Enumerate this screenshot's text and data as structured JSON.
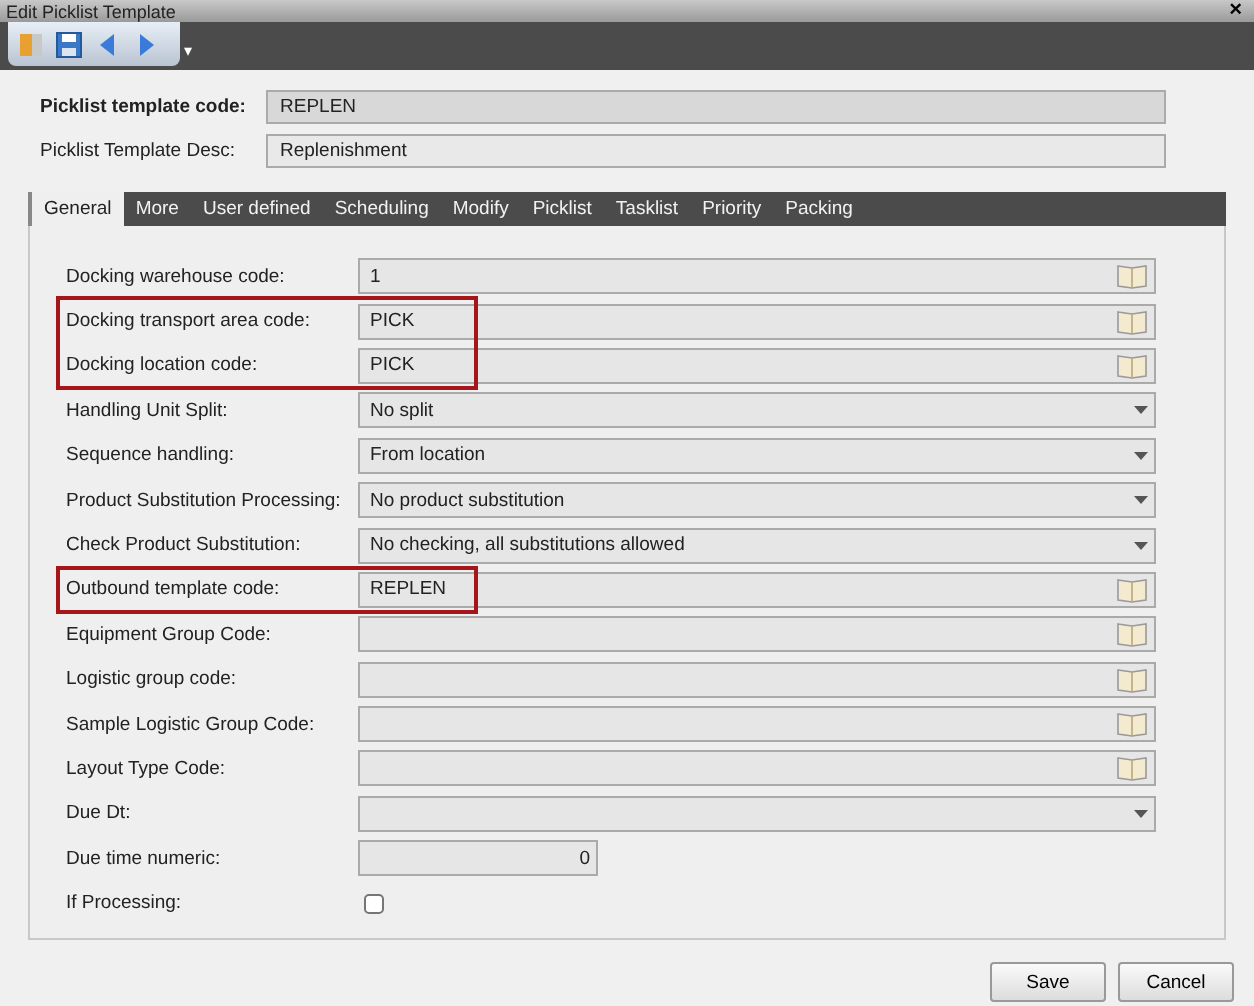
{
  "window": {
    "title": "Edit Picklist Template",
    "close": "×"
  },
  "toolbar": {
    "overflow": "▾"
  },
  "header": [
    {
      "label": "Picklist template code:",
      "value": "REPLEN",
      "bold": true,
      "readonly": true
    },
    {
      "label": "Picklist Template Desc:",
      "value": "Replenishment",
      "bold": false,
      "readonly": false
    }
  ],
  "tabs": [
    {
      "label": "General",
      "selected": true
    },
    {
      "label": "More",
      "selected": false
    },
    {
      "label": "User defined",
      "selected": false
    },
    {
      "label": "Scheduling",
      "selected": false
    },
    {
      "label": "Modify",
      "selected": false
    },
    {
      "label": "Picklist",
      "selected": false
    },
    {
      "label": "Tasklist",
      "selected": false
    },
    {
      "label": "Priority",
      "selected": false
    },
    {
      "label": "Packing",
      "selected": false
    }
  ],
  "fields": [
    {
      "label": "Docking warehouse code:",
      "kind": "lookup",
      "value": "1",
      "highlighted": false
    },
    {
      "label": "Docking transport area code:",
      "kind": "lookup",
      "value": "PICK",
      "highlighted": true
    },
    {
      "label": "Docking location code:",
      "kind": "lookup",
      "value": "PICK",
      "highlighted": true
    },
    {
      "label": "Handling Unit Split:",
      "kind": "select",
      "value": "No split",
      "highlighted": false
    },
    {
      "label": "Sequence handling:",
      "kind": "select",
      "value": "From location",
      "highlighted": false
    },
    {
      "label": "Product Substitution Processing:",
      "kind": "select",
      "value": "No product substitution",
      "highlighted": false
    },
    {
      "label": "Check Product Substitution:",
      "kind": "select",
      "value": "No checking, all substitutions allowed",
      "highlighted": false
    },
    {
      "label": "Outbound template code:",
      "kind": "lookup",
      "value": "REPLEN",
      "highlighted": true
    },
    {
      "label": "Equipment Group Code:",
      "kind": "lookup",
      "highlighted": false
    },
    {
      "label": "Logistic group code:",
      "kind": "lookup",
      "highlighted": false
    },
    {
      "label": "Sample Logistic Group Code:",
      "kind": "lookup",
      "highlighted": false
    },
    {
      "label": "Layout Type Code:",
      "kind": "lookup",
      "highlighted": false
    },
    {
      "label": "Due Dt:",
      "kind": "select",
      "highlighted": false
    },
    {
      "label": "Due time numeric:",
      "kind": "number",
      "value": "0",
      "highlighted": false
    },
    {
      "label": "If Processing:",
      "kind": "checkbox",
      "checked": false,
      "highlighted": false
    }
  ],
  "buttons": [
    "Save",
    "Cancel"
  ]
}
